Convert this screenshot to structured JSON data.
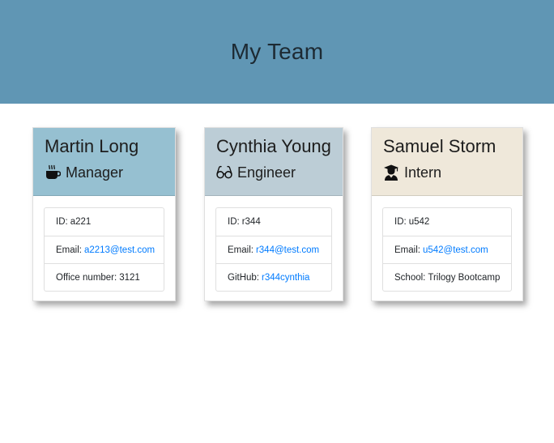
{
  "header": {
    "title": "My Team"
  },
  "colors": {
    "jumbotron": "#6096b4",
    "manager_header": "#96c0d1",
    "engineer_header": "#bccdd6",
    "intern_header": "#efe8da",
    "link": "#007bff"
  },
  "cards": [
    {
      "name": "Martin Long",
      "role": "Manager",
      "icon": "coffee-icon",
      "id_label": "ID:",
      "id_value": "a221",
      "email_label": "Email:",
      "email_value": "a2213@test.com",
      "extra_label": "Office number:",
      "extra_value": "3121"
    },
    {
      "name": "Cynthia Young",
      "role": "Engineer",
      "icon": "glasses-icon",
      "id_label": "ID:",
      "id_value": "r344",
      "email_label": "Email:",
      "email_value": "r344@test.com",
      "extra_label": "GitHub:",
      "extra_value": "r344cynthia"
    },
    {
      "name": "Samuel Storm",
      "role": "Intern",
      "icon": "graduate-icon",
      "id_label": "ID:",
      "id_value": "u542",
      "email_label": "Email:",
      "email_value": "u542@test.com",
      "extra_label": "School:",
      "extra_value": "Trilogy Bootcamp"
    }
  ]
}
